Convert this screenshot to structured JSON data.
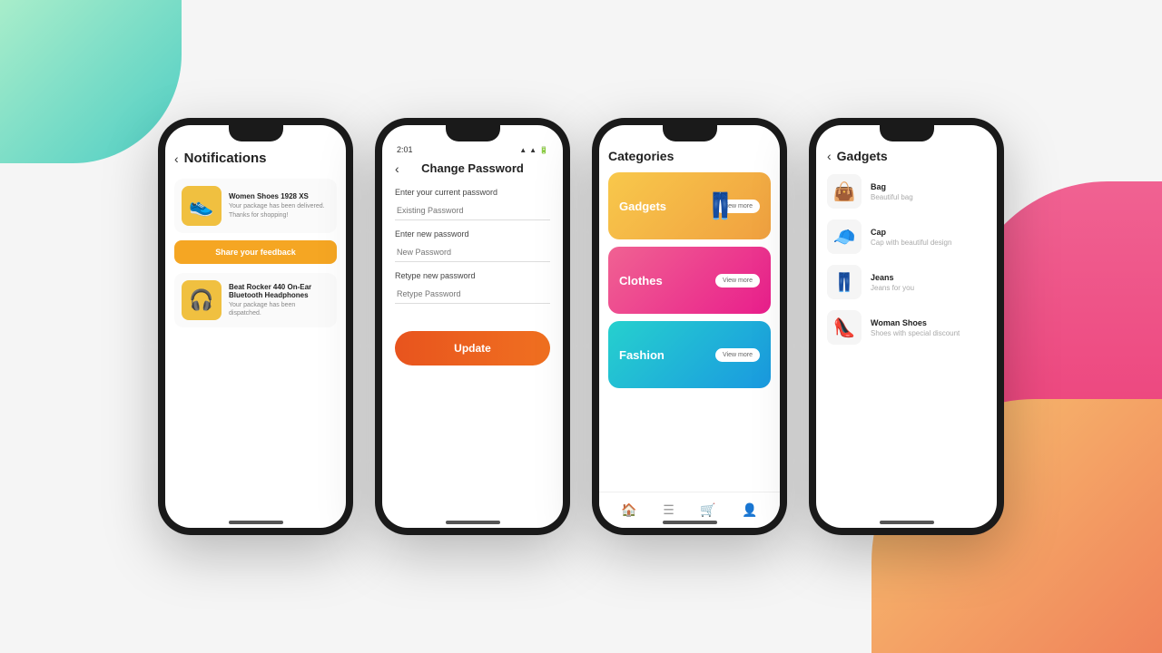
{
  "background": {
    "blob_top_left": "green-teal gradient",
    "blob_bottom_right": "orange gradient",
    "blob_right_pink": "pink gradient"
  },
  "phone1": {
    "header_back": "‹",
    "title": "Notifications",
    "notification1": {
      "icon": "👟",
      "title": "Women Shoes 1928 XS",
      "description": "Your package has been delivered. Thanks for shopping!"
    },
    "feedback_button": "Share your feedback",
    "notification2": {
      "icon": "🎧",
      "title": "Beat Rocker 440 On-Ear Bluetooth Headphones",
      "description": "Your package has been dispatched."
    }
  },
  "phone2": {
    "status_time": "2:01",
    "status_icons": "▲▲🔋",
    "back": "‹",
    "title": "Change Password",
    "field1_label": "Enter your current password",
    "field1_placeholder": "Existing Password",
    "field2_label": "Enter new password",
    "field2_placeholder": "New Password",
    "field3_label": "Retype new password",
    "field3_placeholder": "Retype Password",
    "update_button": "Update"
  },
  "phone3": {
    "title": "Categories",
    "card1": {
      "label": "Gadgets",
      "button": "View more",
      "icon": "👖"
    },
    "card2": {
      "label": "Clothes",
      "button": "View more"
    },
    "card3": {
      "label": "Fashion",
      "button": "View more"
    },
    "nav_icons": [
      "🏠",
      "☰",
      "🛒",
      "👤"
    ]
  },
  "phone4": {
    "back": "‹",
    "title": "Gadgets",
    "items": [
      {
        "icon": "👜",
        "name": "Bag",
        "desc": "Beautiful bag"
      },
      {
        "icon": "🧢",
        "name": "Cap",
        "desc": "Cap with beautiful design"
      },
      {
        "icon": "👖",
        "name": "Jeans",
        "desc": "Jeans for you"
      },
      {
        "icon": "👠",
        "name": "Woman Shoes",
        "desc": "Shoes with special discount"
      }
    ]
  }
}
